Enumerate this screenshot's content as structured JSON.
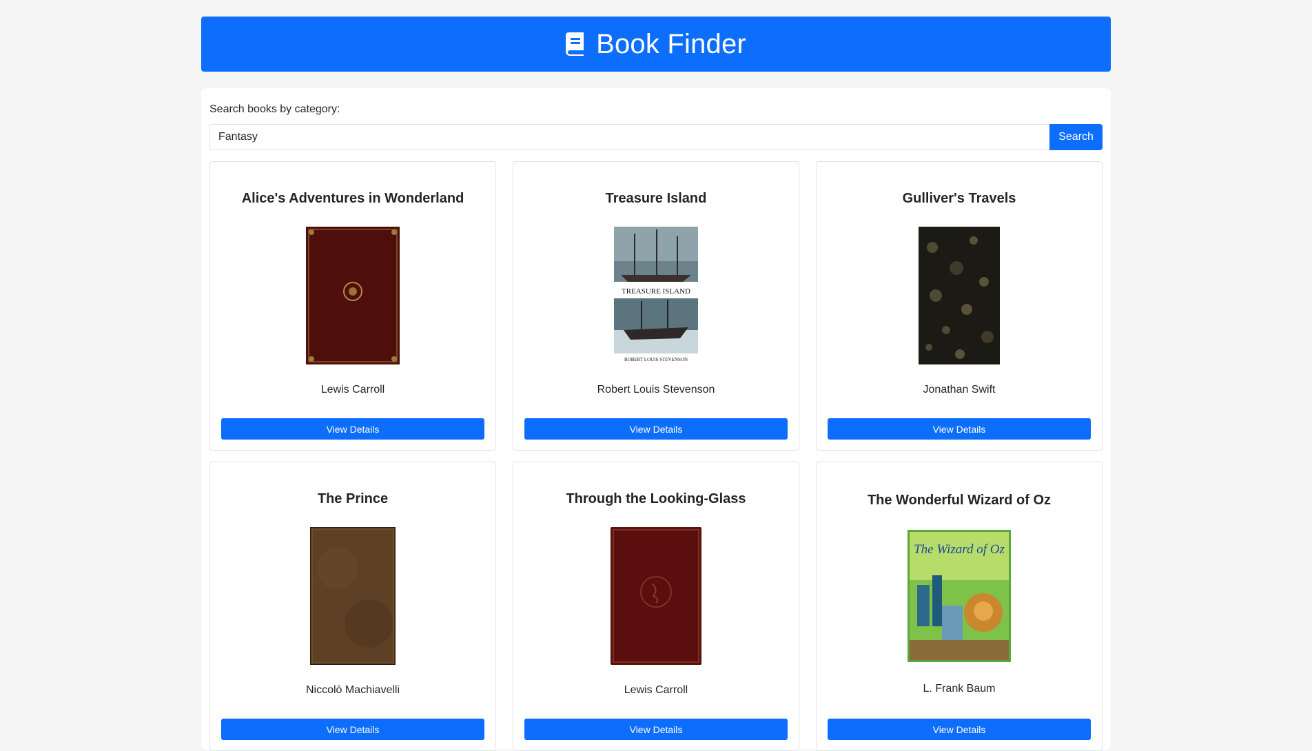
{
  "header": {
    "title": "Book Finder",
    "icon": "book-icon"
  },
  "search": {
    "label": "Search books by category:",
    "value": "Fantasy",
    "button_label": "Search"
  },
  "books": [
    {
      "title": "Alice's Adventures in Wonderland",
      "author": "Lewis Carroll",
      "button_label": "View Details"
    },
    {
      "title": "Treasure Island",
      "author": "Robert Louis Stevenson",
      "button_label": "View Details",
      "cover_text": "TREASURE ISLAND",
      "cover_author": "ROBERT LOUIS STEVENSON"
    },
    {
      "title": "Gulliver's Travels",
      "author": "Jonathan Swift",
      "button_label": "View Details"
    },
    {
      "title": "The Prince",
      "author": "Niccolò Machiavelli",
      "button_label": "View Details"
    },
    {
      "title": "Through the Looking-Glass",
      "author": "Lewis Carroll",
      "button_label": "View Details"
    },
    {
      "title": "The Wonderful Wizard of Oz",
      "author": "L. Frank Baum",
      "button_label": "View Details",
      "cover_text": "The Wizard of Oz"
    }
  ],
  "colors": {
    "accent": "#0d6efd",
    "background": "#f5f5f5"
  }
}
